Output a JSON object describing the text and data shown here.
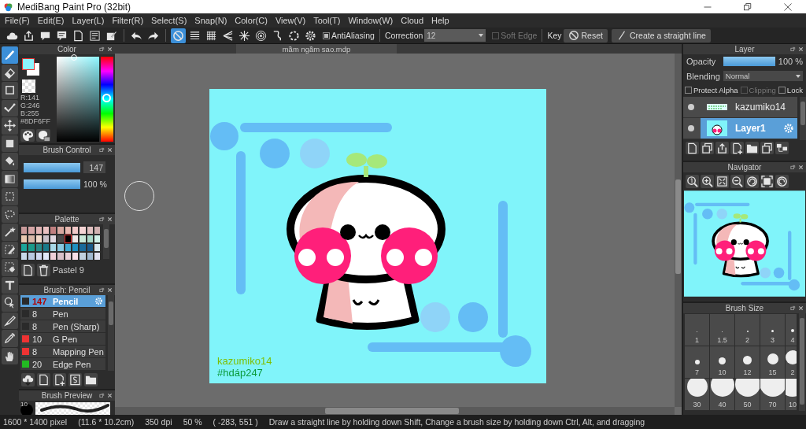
{
  "window": {
    "title": "MediBang Paint Pro (32bit)"
  },
  "menu": [
    "File(F)",
    "Edit(E)",
    "Layer(L)",
    "Filter(R)",
    "Select(S)",
    "Snap(N)",
    "Color(C)",
    "View(V)",
    "Tool(T)",
    "Window(W)",
    "Cloud",
    "Help"
  ],
  "toolbar": {
    "snaps": [
      {
        "kind": "off",
        "selected": true
      },
      {
        "kind": "parallel",
        "selected": false
      },
      {
        "kind": "grid",
        "selected": false
      },
      {
        "kind": "vanish",
        "selected": false
      },
      {
        "kind": "radial",
        "selected": false
      },
      {
        "kind": "concentric",
        "selected": false
      },
      {
        "kind": "curve",
        "selected": false
      },
      {
        "kind": "circle",
        "selected": false
      },
      {
        "kind": "gear",
        "selected": false
      }
    ],
    "antialiasing": {
      "label": "AntiAliasing",
      "checked": true
    },
    "correction": {
      "label": "Correction",
      "value": "12"
    },
    "soft_edge": {
      "label": "Soft Edge",
      "checked": false,
      "disabled": true
    },
    "key_label": "Key",
    "reset": "Reset",
    "straight_line": "Create a straight line"
  },
  "tools": [
    {
      "kind": "brush",
      "selected": true
    },
    {
      "kind": "eraser",
      "selected": false
    },
    {
      "kind": "square",
      "selected": false
    },
    {
      "kind": "polyline",
      "selected": false
    },
    {
      "kind": "move",
      "selected": false
    },
    {
      "kind": "fill",
      "selected": false
    },
    {
      "kind": "bucket",
      "selected": false
    },
    {
      "kind": "gradient",
      "selected": false
    },
    {
      "kind": "select",
      "selected": false
    },
    {
      "kind": "lasso",
      "selected": false
    },
    {
      "kind": "wand",
      "selected": false
    },
    {
      "kind": "selpen",
      "selected": false
    },
    {
      "kind": "selerase",
      "selected": false
    },
    {
      "kind": "text",
      "selected": false
    },
    {
      "kind": "operation",
      "selected": false
    },
    {
      "kind": "knife",
      "selected": false
    },
    {
      "kind": "dropper",
      "selected": false
    },
    {
      "kind": "hand",
      "selected": false
    }
  ],
  "color_panel": {
    "title": "Color",
    "color": "#8df6ff",
    "rgb": [
      "R:141",
      "G:246",
      "B:255"
    ],
    "hex": "#8DF6FF",
    "hue": {
      "level": 0.48
    }
  },
  "brush_control": {
    "title": "Brush Control",
    "size": {
      "level": 1,
      "value": "147"
    },
    "opacity": {
      "level": 1,
      "value": "100 %"
    }
  },
  "palette": {
    "title": "Palette",
    "name": "Pastel 9",
    "swatches": [
      {
        "color": "#c89a9a",
        "selected": false
      },
      {
        "color": "#d4a5a5",
        "selected": false
      },
      {
        "color": "#e0b4b4",
        "selected": false
      },
      {
        "color": "#e8c0c0",
        "selected": false
      },
      {
        "color": "#c08080",
        "selected": false
      },
      {
        "color": "#d8a8a0",
        "selected": false
      },
      {
        "color": "#e8b8b0",
        "selected": false
      },
      {
        "color": "#f0c8c8",
        "selected": false
      },
      {
        "color": "#f4d4d4",
        "selected": false
      },
      {
        "color": "#e0c0c0",
        "selected": false
      },
      {
        "color": "#d0b0b0",
        "selected": false
      },
      {
        "color": "#e8c8b0",
        "selected": false
      },
      {
        "color": "#d8b8a8",
        "selected": false
      },
      {
        "color": "#f0d8c8",
        "selected": false
      },
      {
        "color": "#c8c0c8",
        "selected": false
      },
      {
        "color": "#e0d8e0",
        "selected": false
      },
      {
        "color": "#4a4a4a",
        "selected": false
      },
      {
        "color": "#000000",
        "selected": true
      },
      {
        "color": "#f0e8e8",
        "selected": false
      },
      {
        "color": "#c8e8d8",
        "selected": false
      },
      {
        "color": "#a8d8c8",
        "selected": false
      },
      {
        "color": "#d0f0e8",
        "selected": false
      },
      {
        "color": "#1aa59a",
        "selected": false
      },
      {
        "color": "#1a9a8a",
        "selected": false
      },
      {
        "color": "#2a8a8a",
        "selected": false
      },
      {
        "color": "#1a7a8a",
        "selected": false
      },
      {
        "color": "#a8d8e8",
        "selected": false
      },
      {
        "color": "#88c8e0",
        "selected": false
      },
      {
        "color": "#40a8d0",
        "selected": false
      },
      {
        "color": "#2090c0",
        "selected": false
      },
      {
        "color": "#1a6a9a",
        "selected": false
      },
      {
        "color": "#1a5a8a",
        "selected": false
      },
      {
        "color": "#d8e8f0",
        "selected": false
      },
      {
        "color": "#c8d8e8",
        "selected": false
      },
      {
        "color": "#b8c8e0",
        "selected": false
      },
      {
        "color": "#d0d8f0",
        "selected": false
      },
      {
        "color": "#e0e8f8",
        "selected": false
      },
      {
        "color": "#f0d0d8",
        "selected": false
      },
      {
        "color": "#d8c0c8",
        "selected": false
      },
      {
        "color": "#e8d0d8",
        "selected": false
      },
      {
        "color": "#f8e0e8",
        "selected": false
      },
      {
        "color": "#c0d0e0",
        "selected": false
      },
      {
        "color": "#a0b8d0",
        "selected": false
      },
      {
        "color": "#e0e0f0",
        "selected": false
      }
    ]
  },
  "brush_list": {
    "title": "Brush: Pencil",
    "items": [
      {
        "color": "#2a2a2a",
        "size": "147",
        "name": "Pencil",
        "selected": true
      },
      {
        "color": "#2a2a2a",
        "size": "8",
        "name": "Pen",
        "selected": false
      },
      {
        "color": "#2a2a2a",
        "size": "8",
        "name": "Pen (Sharp)",
        "selected": false
      },
      {
        "color": "#ee3333",
        "size": "10",
        "name": "G Pen",
        "selected": false
      },
      {
        "color": "#ee3333",
        "size": "8",
        "name": "Mapping Pen",
        "selected": false
      },
      {
        "color": "#22bb22",
        "size": "20",
        "name": "Edge Pen",
        "selected": false
      }
    ]
  },
  "brush_preview": {
    "title": "Brush Preview",
    "size": "10"
  },
  "document": {
    "tab": "mầm ngầm sao.mdp",
    "signature": [
      "kazumiko14",
      "#hdáp247"
    ]
  },
  "layer_panel": {
    "title": "Layer",
    "opacity_label": "Opacity",
    "opacity": {
      "level": 1,
      "value": "100 %"
    },
    "blending_label": "Blending",
    "blending": "Normal",
    "options": [
      {
        "label": "Protect Alpha",
        "checked": false,
        "disabled": false
      },
      {
        "label": "Clipping",
        "checked": false,
        "disabled": true
      },
      {
        "label": "Lock",
        "checked": false,
        "disabled": false
      }
    ],
    "layers": [
      {
        "name": "kazumiko14",
        "kind": "text",
        "selected": false
      },
      {
        "name": "Layer1",
        "kind": "art",
        "selected": true
      }
    ]
  },
  "navigator": {
    "title": "Navigator"
  },
  "brush_size": {
    "title": "Brush Size",
    "sizes": [
      "1",
      "1.5",
      "2",
      "3",
      "4",
      "7",
      "10",
      "12",
      "15",
      "2",
      "30",
      "40",
      "50",
      "70",
      "10"
    ]
  },
  "status_bar": [
    "1600 * 1400 pixel",
    "(11.6 * 10.2cm)",
    "350 dpi",
    "50 %",
    "( -283, 551 )",
    "Draw a straight line by holding down Shift, Change a brush size by holding down Ctrl, Alt, and dragging"
  ]
}
